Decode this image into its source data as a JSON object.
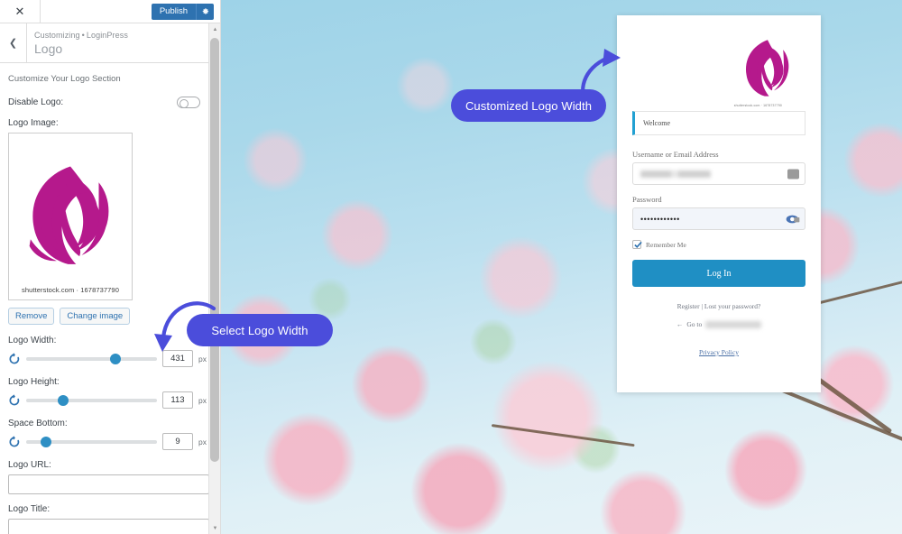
{
  "customizer": {
    "close_icon": "close-icon",
    "publish_label": "Publish",
    "gear_icon": "gear-icon",
    "back_icon": "chevron-left-icon",
    "breadcrumb_root": "Customizing",
    "breadcrumb_sep": "•",
    "breadcrumb_current": "LoginPress",
    "panel_title": "Logo",
    "section_description": "Customize Your Logo Section",
    "controls": {
      "disable_logo_label": "Disable Logo:",
      "disable_logo_state": "off",
      "logo_image_label": "Logo Image:",
      "logo_watermark": "shutterstock.com · 1678737790",
      "remove_label": "Remove",
      "change_image_label": "Change image",
      "logo_width_label": "Logo Width:",
      "logo_width_value": "431",
      "logo_width_unit": "px",
      "logo_width_percent": 68,
      "logo_height_label": "Logo Height:",
      "logo_height_value": "113",
      "logo_height_unit": "px",
      "logo_height_percent": 28,
      "space_bottom_label": "Space Bottom:",
      "space_bottom_value": "9",
      "space_bottom_unit": "px",
      "space_bottom_percent": 15,
      "logo_url_label": "Logo URL:",
      "logo_url_value": "",
      "logo_title_label": "Logo Title:",
      "logo_title_value": ""
    }
  },
  "login_preview": {
    "logo_watermark": "shutterstock.com · 1678737790",
    "welcome_message": "Welcome",
    "username_label": "Username or Email Address",
    "username_value": "",
    "password_label": "Password",
    "password_value": "••••••••••••",
    "remember_label": "Remember Me",
    "remember_checked": "checked",
    "login_button_label": "Log In",
    "register_links": "Register | Lost your password?",
    "goto_arrow": "←",
    "goto_label": "Go to",
    "privacy_label": "Privacy Policy"
  },
  "annotations": {
    "customized_logo_width": "Customized Logo Width",
    "select_logo_width": "Select Logo Width"
  },
  "colors": {
    "accent_blue": "#2e72b0",
    "slider_blue": "#2e8fc4",
    "annotation_purple": "#4b4ddb",
    "login_button": "#1f8fc4",
    "logo_magenta": "#b5198c"
  }
}
